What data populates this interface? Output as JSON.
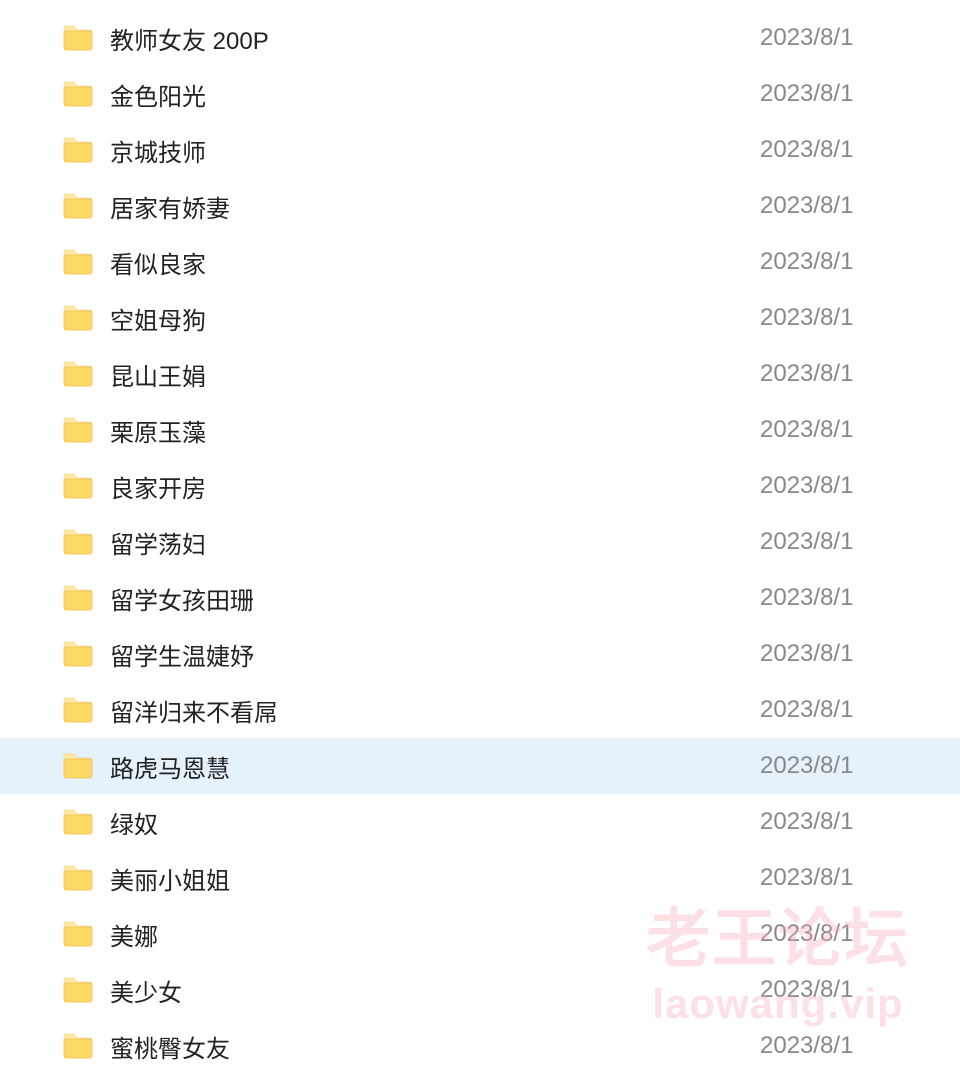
{
  "folders": [
    {
      "name": "教师女友 200P",
      "date": "2023/8/1",
      "selected": false
    },
    {
      "name": "金色阳光",
      "date": "2023/8/1",
      "selected": false
    },
    {
      "name": "京城技师",
      "date": "2023/8/1",
      "selected": false
    },
    {
      "name": "居家有娇妻",
      "date": "2023/8/1",
      "selected": false
    },
    {
      "name": "看似良家",
      "date": "2023/8/1",
      "selected": false
    },
    {
      "name": "空姐母狗",
      "date": "2023/8/1",
      "selected": false
    },
    {
      "name": "昆山王娟",
      "date": "2023/8/1",
      "selected": false
    },
    {
      "name": "栗原玉藻",
      "date": "2023/8/1",
      "selected": false
    },
    {
      "name": "良家开房",
      "date": "2023/8/1",
      "selected": false
    },
    {
      "name": "留学荡妇",
      "date": "2023/8/1",
      "selected": false
    },
    {
      "name": "留学女孩田珊",
      "date": "2023/8/1",
      "selected": false
    },
    {
      "name": "留学生温婕妤",
      "date": "2023/8/1",
      "selected": false
    },
    {
      "name": "留洋归来不看屌",
      "date": "2023/8/1",
      "selected": false
    },
    {
      "name": "路虎马恩慧",
      "date": "2023/8/1",
      "selected": true
    },
    {
      "name": "绿奴",
      "date": "2023/8/1",
      "selected": false
    },
    {
      "name": "美丽小姐姐",
      "date": "2023/8/1",
      "selected": false
    },
    {
      "name": "美娜",
      "date": "2023/8/1",
      "selected": false
    },
    {
      "name": "美少女",
      "date": "2023/8/1",
      "selected": false
    },
    {
      "name": "蜜桃臀女友",
      "date": "2023/8/1",
      "selected": false
    }
  ],
  "watermark": {
    "line1": "老王论坛",
    "line2": "laowang.vip"
  }
}
